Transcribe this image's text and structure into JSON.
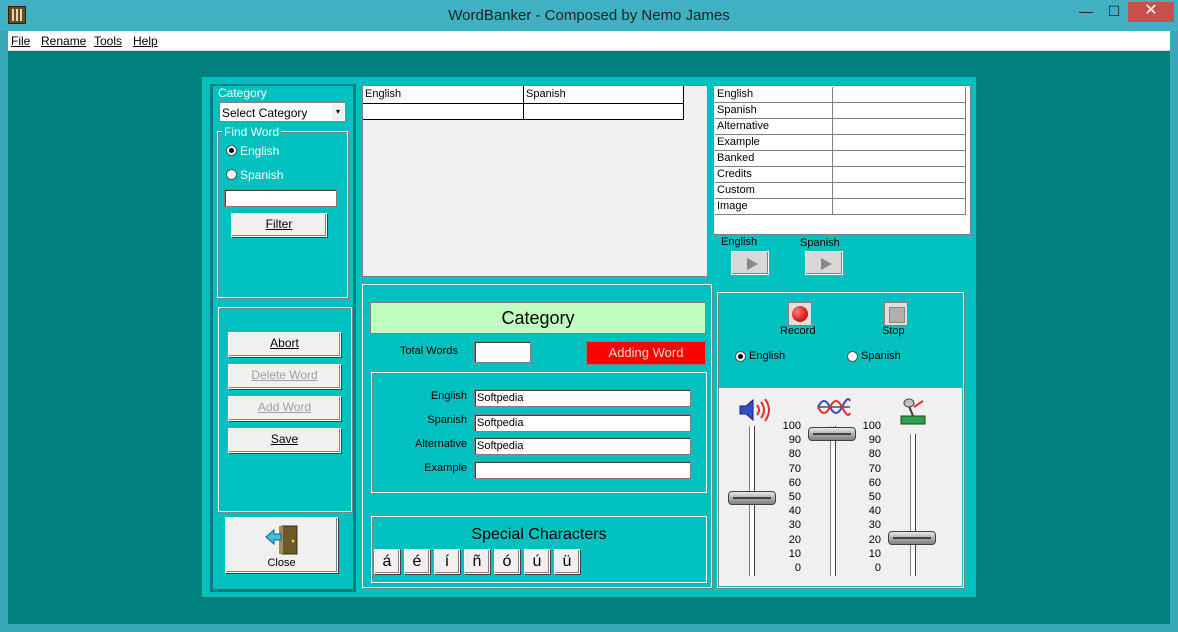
{
  "window": {
    "title": "WordBanker - Composed by Nemo James",
    "min_label": "—",
    "max_label": "☐",
    "close_label": "✕"
  },
  "menu": [
    "File",
    "Rename",
    "Tools",
    "Help"
  ],
  "left": {
    "category_label": "Category",
    "category_select": "Select Category",
    "find_word_label": "Find Word",
    "radio_english": "English",
    "radio_spanish": "Spanish",
    "filter_value": "",
    "filter_button": "Filter",
    "abort_button": "Abort",
    "delete_button": "Delete Word",
    "add_button": "Add Word",
    "save_button": "Save",
    "close_button": "Close"
  },
  "word_list": {
    "columns": [
      "English",
      "Spanish"
    ]
  },
  "details": {
    "rows": [
      "English",
      "Spanish",
      "Alternative",
      "Example",
      "Banked",
      "Credits",
      "Custom",
      "Image"
    ],
    "play_english_label": "English",
    "play_spanish_label": "Spanish"
  },
  "editor": {
    "category_header": "Category",
    "total_words_label": "Total Words",
    "total_words_value": "",
    "status_label": "Adding Word",
    "fields": [
      {
        "label": "English",
        "value": "Softpedia"
      },
      {
        "label": "Spanish",
        "value": "Softpedia"
      },
      {
        "label": "Alternative",
        "value": "Softpedia"
      },
      {
        "label": "Example",
        "value": ""
      }
    ],
    "special_title": "Special Characters",
    "special_chars": [
      "á",
      "é",
      "í",
      "ñ",
      "ó",
      "ú",
      "ü"
    ]
  },
  "recorder": {
    "record_label": "Record",
    "stop_label": "Stop",
    "radio_english": "English",
    "radio_spanish": "Spanish",
    "scale": [
      "100",
      "90",
      "80",
      "70",
      "60",
      "50",
      "40",
      "30",
      "20",
      "10",
      "0"
    ],
    "volume_level": 50,
    "wave_level": 95,
    "mic_level": 21,
    "colors": {
      "record": "#e02020",
      "status_bg": "#ff0000",
      "category_bg": "#c0ffc0"
    },
    "icons": [
      "speaker-icon",
      "wave-icon",
      "microphone-icon"
    ]
  }
}
